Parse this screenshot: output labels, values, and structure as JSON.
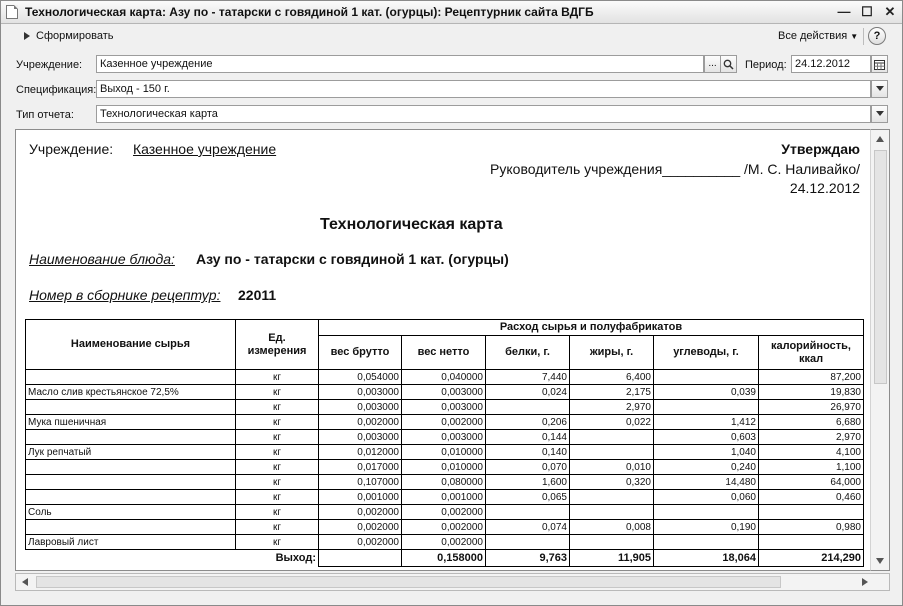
{
  "window": {
    "title": "Технологическая карта: Азу по - татарски с говядиной 1 кат. (огурцы): Рецептурник сайта ВДГБ",
    "minimize": "—",
    "maximize": "☐",
    "close": "✕"
  },
  "toolbar": {
    "run_label": "Сформировать",
    "actions_label": "Все действия",
    "help_label": "?"
  },
  "params": {
    "institution": {
      "label": "Учреждение:",
      "value": "Казенное учреждение",
      "select_btn": "...",
      "search_icon": "magnifier-icon"
    },
    "period": {
      "label": "Период:",
      "value": "24.12.2012",
      "calendar_icon": "calendar-icon"
    },
    "spec": {
      "label": "Спецификация:",
      "value": "Выход - 150 г."
    },
    "report_type": {
      "label": "Тип отчета:",
      "value": "Технологическая карта"
    }
  },
  "report": {
    "institution_label": "Учреждение:",
    "institution_value": "Казенное учреждение",
    "approve": "Утверждаю",
    "director_line": "Руководитель учреждения__________ /М. С. Наливайко/",
    "date": "24.12.2012",
    "heading": "Технологическая карта",
    "dish_label": "Наименование  блюда:",
    "dish_value": "Азу по - татарски с говядиной 1 кат. (огурцы)",
    "collection_label": "Номер в сборнике рецептур:",
    "collection_value": "22011",
    "table": {
      "col_name": "Наименование сырья",
      "col_unit": "Ед. измерения",
      "group_header": "Расход сырья и полуфабрикатов",
      "col_gross": "вес брутто",
      "col_net": "вес нетто",
      "col_protein": "белки, г.",
      "col_fat": "жиры, г.",
      "col_carbs": "углеводы, г.",
      "col_kcal": "калорийность, ккал",
      "rows": [
        {
          "name": "",
          "unit": "кг",
          "gross": "0,054000",
          "net": "0,040000",
          "protein": "7,440",
          "fat": "6,400",
          "carbs": "",
          "kcal": "87,200"
        },
        {
          "name": "Масло слив крестьянское 72,5%",
          "unit": "кг",
          "gross": "0,003000",
          "net": "0,003000",
          "protein": "0,024",
          "fat": "2,175",
          "carbs": "0,039",
          "kcal": "19,830"
        },
        {
          "name": "",
          "unit": "кг",
          "gross": "0,003000",
          "net": "0,003000",
          "protein": "",
          "fat": "2,970",
          "carbs": "",
          "kcal": "26,970"
        },
        {
          "name": "Мука пшеничная",
          "unit": "кг",
          "gross": "0,002000",
          "net": "0,002000",
          "protein": "0,206",
          "fat": "0,022",
          "carbs": "1,412",
          "kcal": "6,680"
        },
        {
          "name": "",
          "unit": "кг",
          "gross": "0,003000",
          "net": "0,003000",
          "protein": "0,144",
          "fat": "",
          "carbs": "0,603",
          "kcal": "2,970"
        },
        {
          "name": "Лук репчатый",
          "unit": "кг",
          "gross": "0,012000",
          "net": "0,010000",
          "protein": "0,140",
          "fat": "",
          "carbs": "1,040",
          "kcal": "4,100"
        },
        {
          "name": "",
          "unit": "кг",
          "gross": "0,017000",
          "net": "0,010000",
          "protein": "0,070",
          "fat": "0,010",
          "carbs": "0,240",
          "kcal": "1,100"
        },
        {
          "name": "",
          "unit": "кг",
          "gross": "0,107000",
          "net": "0,080000",
          "protein": "1,600",
          "fat": "0,320",
          "carbs": "14,480",
          "kcal": "64,000"
        },
        {
          "name": "",
          "unit": "кг",
          "gross": "0,001000",
          "net": "0,001000",
          "protein": "0,065",
          "fat": "",
          "carbs": "0,060",
          "kcal": "0,460"
        },
        {
          "name": "Соль",
          "unit": "кг",
          "gross": "0,002000",
          "net": "0,002000",
          "protein": "",
          "fat": "",
          "carbs": "",
          "kcal": ""
        },
        {
          "name": "",
          "unit": "кг",
          "gross": "0,002000",
          "net": "0,002000",
          "protein": "0,074",
          "fat": "0,008",
          "carbs": "0,190",
          "kcal": "0,980"
        },
        {
          "name": "Лавровый лист",
          "unit": "кг",
          "gross": "0,002000",
          "net": "0,002000",
          "protein": "",
          "fat": "",
          "carbs": "",
          "kcal": ""
        }
      ],
      "total": {
        "label": "Выход:",
        "gross": "",
        "net": "0,158000",
        "protein": "9,763",
        "fat": "11,905",
        "carbs": "18,064",
        "kcal": "214,290"
      }
    }
  }
}
